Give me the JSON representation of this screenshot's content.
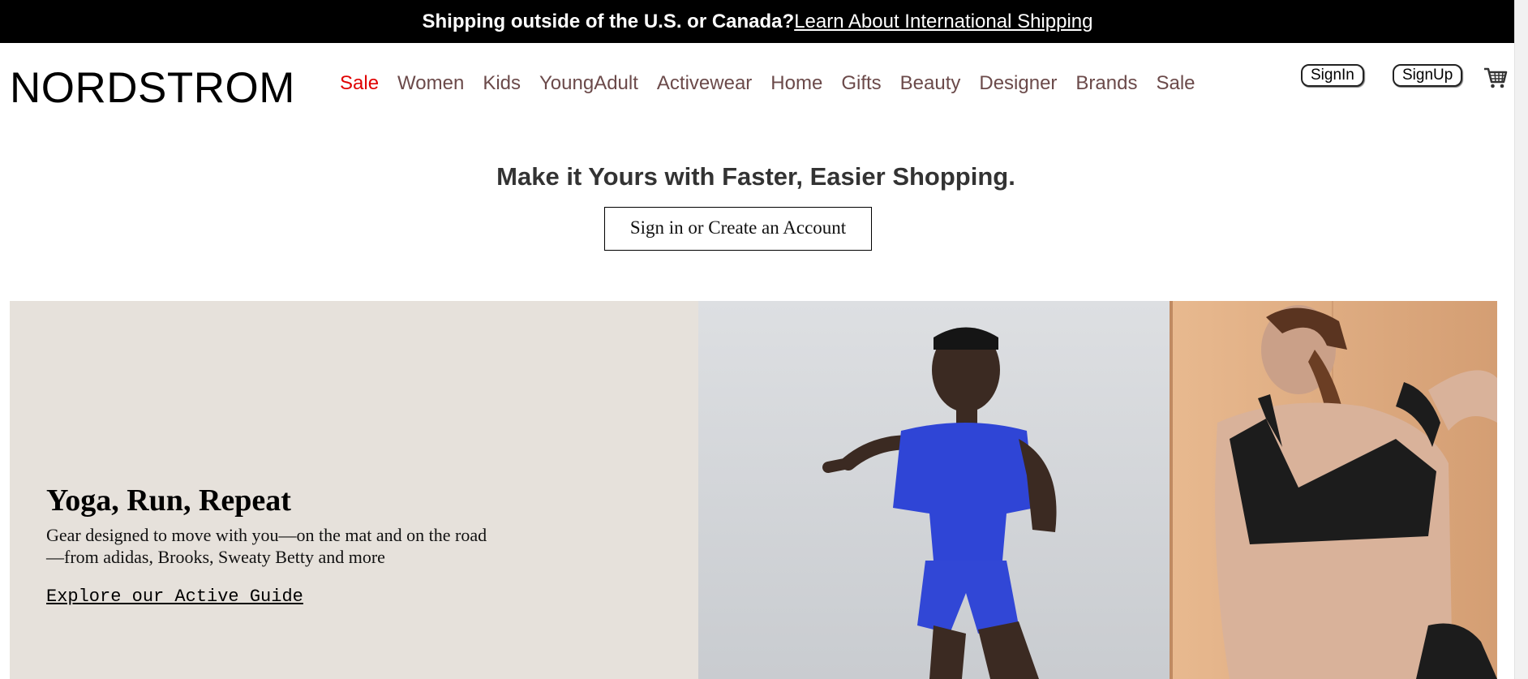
{
  "announcement": {
    "text": "Shipping outside of the U.S. or Canada?",
    "link": "Learn About International Shipping"
  },
  "header": {
    "logo": "NORDSTROM",
    "nav": [
      "Sale",
      "Women",
      "Kids",
      "YoungAdult",
      "Activewear",
      "Home",
      "Gifts",
      "Beauty",
      "Designer",
      "Brands",
      "Sale"
    ],
    "sign_in": "SignIn",
    "sign_up": "SignUp",
    "cart_icon": "shopping-cart-icon"
  },
  "promo": {
    "heading": "Make it Yours with Faster, Easier Shopping.",
    "button": "Sign in or Create an Account"
  },
  "hero": {
    "title": "Yoga, Run, Repeat",
    "description": "Gear designed to move with you—on the mat and on the road—from adidas, Brooks, Sweaty Betty and more",
    "link": "Explore our Active Guide"
  },
  "colors": {
    "sale": "#e00000",
    "nav": "#6b4a4a",
    "hero_bg": "#e6e1db",
    "topbar_bg": "#000000"
  }
}
